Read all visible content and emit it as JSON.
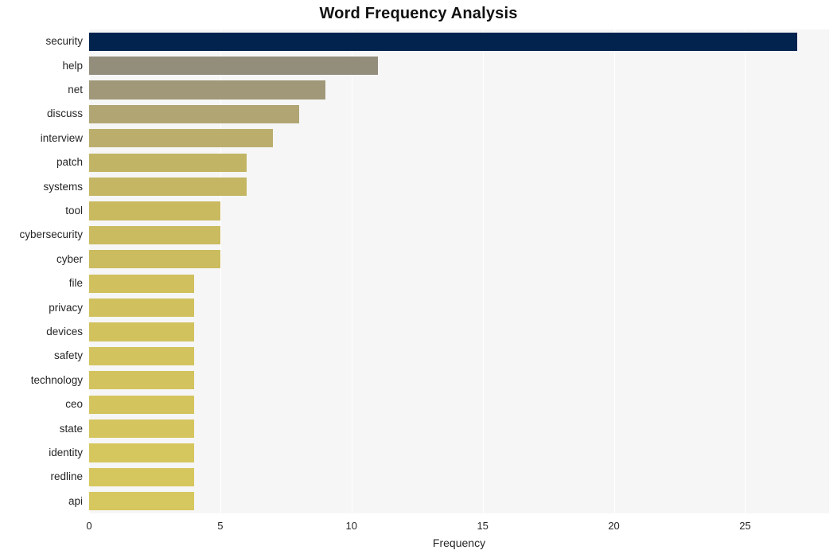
{
  "chart_data": {
    "type": "bar",
    "orientation": "horizontal",
    "title": "Word Frequency Analysis",
    "xlabel": "Frequency",
    "ylabel": "",
    "xlim": [
      0,
      28.2
    ],
    "xticks": [
      0,
      5,
      10,
      15,
      20,
      25
    ],
    "xtick_labels": [
      "0",
      "5",
      "10",
      "15",
      "20",
      "25"
    ],
    "grid": "vertical-only",
    "legend": "none",
    "categories": [
      "security",
      "help",
      "net",
      "discuss",
      "interview",
      "patch",
      "systems",
      "tool",
      "cybersecurity",
      "cyber",
      "file",
      "privacy",
      "devices",
      "safety",
      "technology",
      "ceo",
      "state",
      "identity",
      "redline",
      "api"
    ],
    "values": [
      27,
      11,
      9,
      8,
      7,
      6,
      6,
      5,
      5,
      5,
      4,
      4,
      4,
      4,
      4,
      4,
      4,
      4,
      4,
      4
    ],
    "bar_colors": [
      "#03234f",
      "#938d7c",
      "#a09878",
      "#b0a573",
      "#bbae6c",
      "#c2b465",
      "#c4b663",
      "#c9ba60",
      "#cabb60",
      "#cbbc5f",
      "#d0c05e",
      "#d1c15e",
      "#d2c25e",
      "#d3c35e",
      "#d3c35e",
      "#d4c45e",
      "#d5c55e",
      "#d5c65e",
      "#d6c65e",
      "#d6c75e"
    ],
    "plot_background": "#f6f6f6",
    "gridline_color": "#ffffff",
    "figure_background": "#ffffff",
    "text_color": "#262626",
    "title_color": "#111111"
  }
}
